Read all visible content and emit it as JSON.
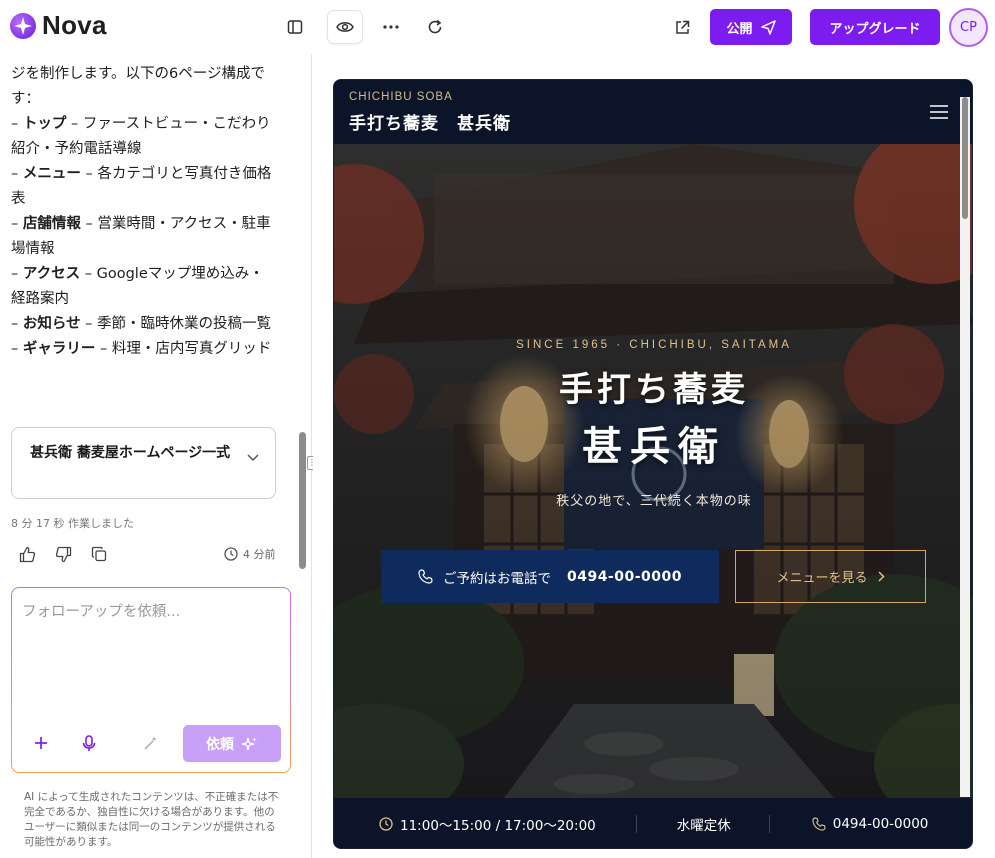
{
  "app": {
    "name": "Nova"
  },
  "toolbar": {
    "publish_label": "公開",
    "upgrade_label": "アップグレード",
    "avatar_initials": "CP",
    "accent_color": "#7c1cf0"
  },
  "chat": {
    "lines": [
      {
        "bold": "",
        "text": "ジを制作します。以下の6ページ構成です："
      },
      {
        "bold": "トップ",
        "text": " – ファーストビュー・こだわり紹介・予約電話導線"
      },
      {
        "bold": "メニュー",
        "text": " – 各カテゴリと写真付き価格表"
      },
      {
        "bold": "店舗情報",
        "text": " – 営業時間・アクセス・駐車場情報"
      },
      {
        "bold": "アクセス",
        "text": " – Googleマップ埋め込み・経路案内"
      },
      {
        "bold": "お知らせ",
        "text": " – 季節・臨時休業の投稿一覧"
      },
      {
        "bold": "ギャラリー",
        "text": " – 料理・店内写真グリッド"
      }
    ],
    "artifact_title": "甚兵衛 蕎麦屋ホームページ一式",
    "worked_time": "8 分 17 秒 作業しました",
    "time_ago": "4 分前",
    "composer_placeholder": "フォローアップを依頼...",
    "send_label": "依頼",
    "disclaimer": "AI によって生成されたコンテンツは、不正確または不完全であるか、独自性に欠ける場合があります。他のユーザーに類似または同一のコンテンツが提供される可能性があります。"
  },
  "site": {
    "brand_small": "CHICHIBU SOBA",
    "brand": "手打ち蕎麦　甚兵衛",
    "hero": {
      "eyebrow": "SINCE 1965 · CHICHIBU, SAITAMA",
      "title1": "手打ち蕎麦",
      "title2": "甚兵衛",
      "subtitle": "秩父の地で、三代続く本物の味",
      "call_label": "ご予約はお電話で",
      "call_number": "0494-00-0000",
      "menu_label": "メニューを見る"
    },
    "info": {
      "hours": "11:00〜15:00 / 17:00〜20:00",
      "closed": "水曜定休",
      "phone": "0494-00-0000"
    },
    "colors": {
      "navy": "#0b1428",
      "gold": "#d4a860",
      "cta": "#0f2a5c"
    }
  },
  "icons": [
    "sidebar-toggle-icon",
    "eye-icon",
    "more-icon",
    "refresh-icon",
    "external-link-icon",
    "send-icon",
    "chevron-down-icon",
    "thumbs-up-icon",
    "thumbs-down-icon",
    "copy-icon",
    "clock-icon",
    "plus-icon",
    "mic-icon",
    "magic-wand-icon",
    "sparkle-icon",
    "hamburger-icon",
    "phone-icon",
    "chevron-right-icon"
  ]
}
